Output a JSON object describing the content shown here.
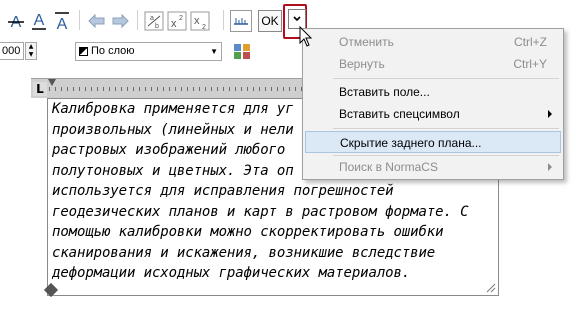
{
  "toolbar": {
    "undo_icon": "undo-arrow-icon",
    "redo_icon": "redo-arrow-icon",
    "ok_label": "OK",
    "options_icon": "chevron-down-icon"
  },
  "format_bar": {
    "spin_value": "000",
    "layer_value": "По слою"
  },
  "text_editor": {
    "lines": [
      "Калибровка применяется для уг",
      "произвольных (линейных и нели",
      "растровых изображений любого",
      "полутоновых и цветных. Эта оп",
      "используется для исправления погрешностей",
      "геодезических планов и карт в растровом формате. С",
      "помощью калибровки можно скорректировать ошибки",
      "сканирования и искажения, возникшие вследствие",
      "деформации исходных графических материалов."
    ]
  },
  "context_menu": {
    "items": [
      {
        "label": "Отменить",
        "shortcut": "Ctrl+Z",
        "disabled": true
      },
      {
        "label": "Вернуть",
        "shortcut": "Ctrl+Y",
        "disabled": true
      },
      {
        "label": "Вставить поле...",
        "shortcut": "",
        "disabled": false
      },
      {
        "label": "Вставить спецсимвол",
        "shortcut": "",
        "disabled": false,
        "submenu": true
      },
      {
        "label": "Скрытие заднего плана...",
        "shortcut": "",
        "disabled": false,
        "highlighted": true
      },
      {
        "label": "Поиск в NormaCS",
        "shortcut": "",
        "disabled": true,
        "submenu": true
      }
    ]
  },
  "colors": {
    "highlight_frame": "#b0101c",
    "menu_highlight": "#dbe8f6",
    "strike_icon_blue": "#1a5fb4"
  }
}
